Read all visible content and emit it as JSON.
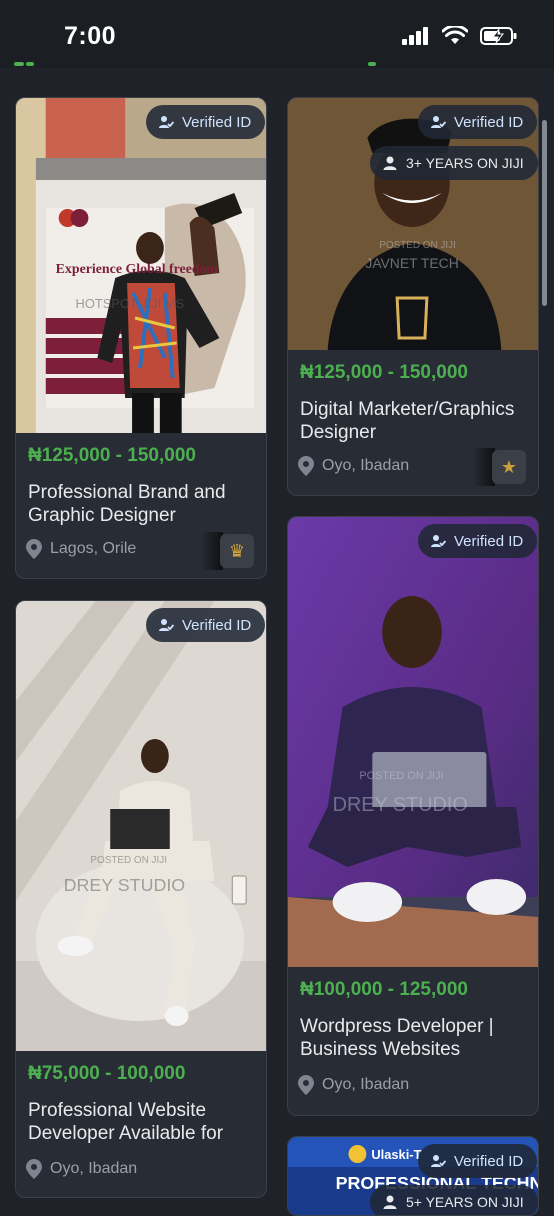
{
  "status": {
    "time": "7:00",
    "icons": [
      "cellular-signal-icon",
      "wifi-icon",
      "battery-charging-icon"
    ]
  },
  "colors": {
    "background": "#1f2329",
    "card": "#282c34",
    "price": "#4caf50",
    "badge_bg": "#202836"
  },
  "listings": [
    {
      "badge_verified": "Verified ID",
      "price": "₦125,000 - 150,000",
      "title": "Professional Brand and Graphic Designer",
      "location": "Lagos, Orile",
      "seller_icon": "crown-icon"
    },
    {
      "badge_verified": "Verified ID",
      "badge_years": "3+ YEARS ON JIJI",
      "price": "₦125,000 - 150,000",
      "title": "Digital Marketer/Graphics Designer",
      "location": "Oyo, Ibadan",
      "seller_icon": "star-icon"
    },
    {
      "badge_verified": "Verified ID",
      "price": "₦75,000 - 100,000",
      "title": "Professional Website Developer Available for",
      "location": "Oyo, Ibadan"
    },
    {
      "badge_verified": "Verified ID",
      "price": "₦100,000 - 125,000",
      "title": "Wordpress Developer | Business Websites",
      "location": "Oyo, Ibadan"
    },
    {
      "badge_verified": "Verified ID",
      "badge_years": "5+ YEARS ON JIJI"
    }
  ],
  "watermarks": {
    "c1_poster": "Experience Global freedom",
    "c1_wm": "HOTSPOT JIJI MS",
    "c2_wm1": "POSTED ON JIJI",
    "c2_wm2": "JAVNET TECH",
    "c3_wm1": "POSTED ON JIJI",
    "c3_wm2": "DREY STUDIO",
    "c4_wm1": "POSTED ON JIJI",
    "c4_wm2": "DREY STUDIO",
    "c5_text1": "Ulaski-T",
    "c5_text2": "PROFESSIONAL TECHN"
  }
}
